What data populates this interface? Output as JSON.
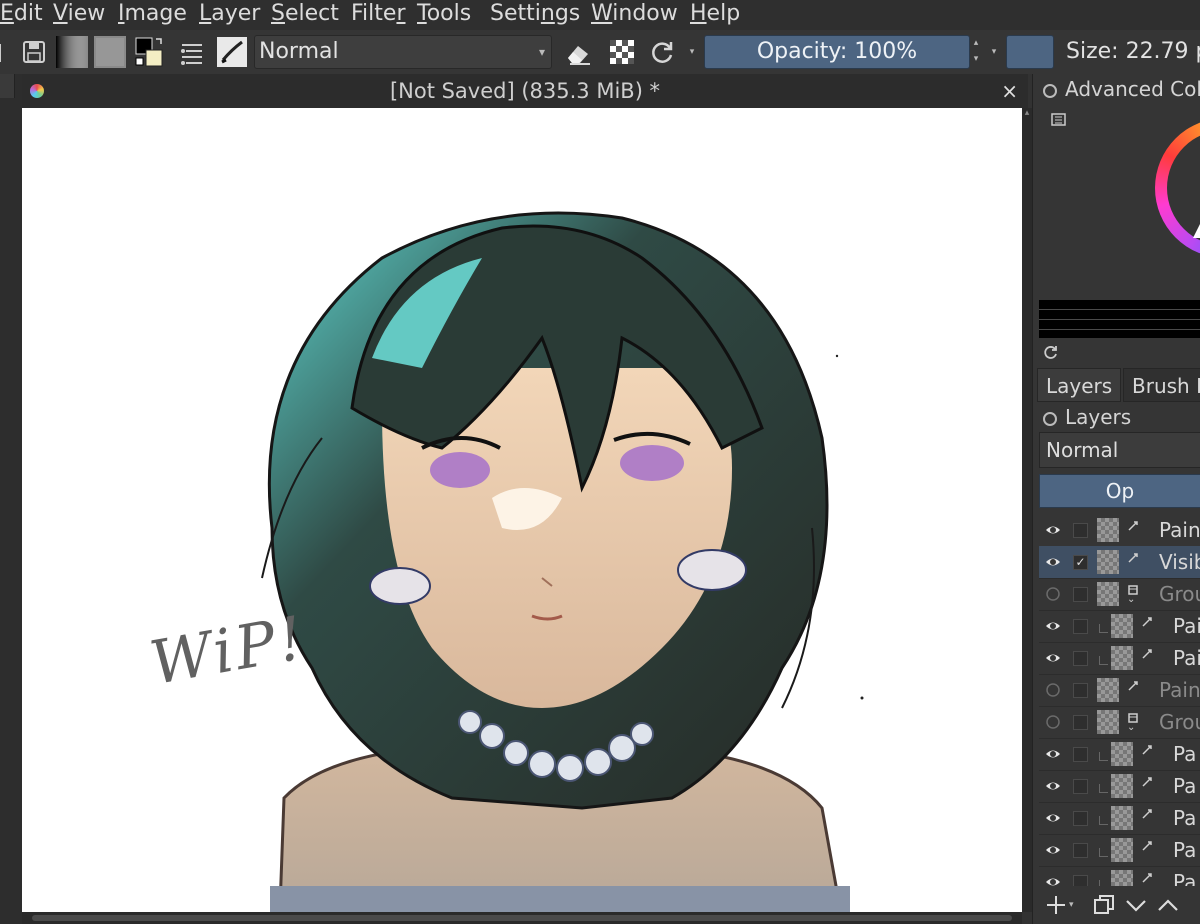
{
  "menubar": {
    "items": [
      {
        "pre": "",
        "u": "E",
        "post": "dit"
      },
      {
        "pre": "",
        "u": "V",
        "post": "iew"
      },
      {
        "pre": "",
        "u": "I",
        "post": "mage"
      },
      {
        "pre": "",
        "u": "L",
        "post": "ayer"
      },
      {
        "pre": "",
        "u": "S",
        "post": "elect"
      },
      {
        "pre": "Filte",
        "u": "r",
        "post": ""
      },
      {
        "pre": "",
        "u": "T",
        "post": "ools"
      },
      {
        "pre": "Setti",
        "u": "n",
        "post": "gs"
      },
      {
        "pre": "",
        "u": "W",
        "post": "indow"
      },
      {
        "pre": "",
        "u": "H",
        "post": "elp"
      }
    ]
  },
  "toolbar": {
    "blend_mode": "Normal",
    "opacity_label": "Opacity: 100%",
    "size_label": "Size: 22.79 p"
  },
  "document": {
    "title": "[Not Saved]  (835.3 MiB) *",
    "close_glyph": "×",
    "canvas_text": "WiP!"
  },
  "dockers": {
    "color_title": "Advanced Colo",
    "tabs": [
      "Layers",
      "Brush P"
    ],
    "layers_title": "Layers",
    "layers_blend": "Normal",
    "layers_opacity": "Op",
    "layers": [
      {
        "name": "Pain",
        "visible": true,
        "checked": false,
        "kind": "paint",
        "selected": false,
        "dim": false,
        "indent": false
      },
      {
        "name": "Visib",
        "visible": true,
        "checked": true,
        "kind": "paint",
        "selected": true,
        "dim": false,
        "indent": false
      },
      {
        "name": "Grou",
        "visible": false,
        "checked": false,
        "kind": "group",
        "selected": false,
        "dim": true,
        "indent": false
      },
      {
        "name": "Pai",
        "visible": true,
        "checked": false,
        "kind": "paint",
        "selected": false,
        "dim": false,
        "indent": true
      },
      {
        "name": "Pai",
        "visible": true,
        "checked": false,
        "kind": "paint",
        "selected": false,
        "dim": false,
        "indent": true
      },
      {
        "name": "Pain",
        "visible": false,
        "checked": false,
        "kind": "paint",
        "selected": false,
        "dim": true,
        "indent": false
      },
      {
        "name": "Grou",
        "visible": false,
        "checked": false,
        "kind": "group",
        "selected": false,
        "dim": true,
        "indent": false
      },
      {
        "name": "Pa",
        "visible": true,
        "checked": false,
        "kind": "paint",
        "selected": false,
        "dim": false,
        "indent": true
      },
      {
        "name": "Pa",
        "visible": true,
        "checked": false,
        "kind": "paint",
        "selected": false,
        "dim": false,
        "indent": true
      },
      {
        "name": "Pa",
        "visible": true,
        "checked": false,
        "kind": "paint",
        "selected": false,
        "dim": false,
        "indent": true
      },
      {
        "name": "Pa",
        "visible": true,
        "checked": false,
        "kind": "paint",
        "selected": false,
        "dim": false,
        "indent": true
      },
      {
        "name": "Pa",
        "visible": true,
        "checked": false,
        "kind": "paint",
        "selected": false,
        "dim": false,
        "indent": true
      }
    ]
  },
  "colors": {
    "accent": "#4d6582",
    "selected_row": "#3f4f63"
  }
}
